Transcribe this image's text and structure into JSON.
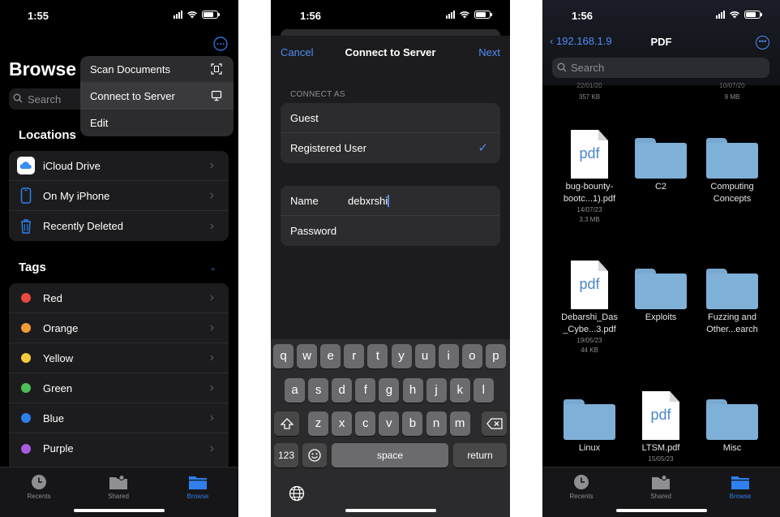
{
  "status": {
    "p1_time": "1:55",
    "p2_time": "1:56",
    "p3_time": "1:56"
  },
  "browse": {
    "title": "Browse",
    "search_placeholder": "Search",
    "locations_header": "Locations",
    "locations": [
      {
        "label": "iCloud Drive",
        "icon": "icloud-icon"
      },
      {
        "label": "On My iPhone",
        "icon": "iphone-icon"
      },
      {
        "label": "Recently Deleted",
        "icon": "trash-icon"
      }
    ],
    "tags_header": "Tags",
    "tags": [
      {
        "label": "Red",
        "color": "#e9493f"
      },
      {
        "label": "Orange",
        "color": "#f19a38"
      },
      {
        "label": "Yellow",
        "color": "#f4cb3a"
      },
      {
        "label": "Green",
        "color": "#4cbf5a"
      },
      {
        "label": "Blue",
        "color": "#2f80ed"
      },
      {
        "label": "Purple",
        "color": "#a95be0"
      }
    ],
    "menu": [
      {
        "label": "Scan Documents",
        "icon": "scan-icon"
      },
      {
        "label": "Connect to Server",
        "icon": "monitor-icon"
      },
      {
        "label": "Edit"
      }
    ]
  },
  "tabbar": {
    "recents": "Recents",
    "shared": "Shared",
    "browse": "Browse"
  },
  "connect": {
    "cancel": "Cancel",
    "title": "Connect to Server",
    "next": "Next",
    "connect_as": "CONNECT AS",
    "guest": "Guest",
    "registered": "Registered User",
    "name_label": "Name",
    "name_value": "debxrshi",
    "password_label": "Password"
  },
  "keyboard": {
    "row1": [
      "q",
      "w",
      "e",
      "r",
      "t",
      "y",
      "u",
      "i",
      "o",
      "p"
    ],
    "row2": [
      "a",
      "s",
      "d",
      "f",
      "g",
      "h",
      "j",
      "k",
      "l"
    ],
    "row3": [
      "z",
      "x",
      "c",
      "v",
      "b",
      "n",
      "m"
    ],
    "num": "123",
    "space": "space",
    "return": "return"
  },
  "folder_view": {
    "back": "192.168.1.9",
    "title": "PDF",
    "search_placeholder": "Search",
    "partial_top": [
      {
        "meta": "22/01/20",
        "size": "357 KB"
      },
      {
        "meta": "10/07/20",
        "size": "9 MB"
      }
    ],
    "doc_label": "pdf",
    "items": [
      {
        "type": "pdf",
        "name1": "bug-bounty-",
        "name2": "bootc...1).pdf",
        "date": "14/07/23",
        "size": "3.3 MB"
      },
      {
        "type": "folder",
        "name1": "C2",
        "name2": ""
      },
      {
        "type": "folder",
        "name1": "Computing",
        "name2": "Concepts"
      },
      {
        "type": "pdf",
        "name1": "Debarshi_Das",
        "name2": "_Cybe...3.pdf",
        "date": "19/05/23",
        "size": "44 KB"
      },
      {
        "type": "folder",
        "name1": "Exploits",
        "name2": ""
      },
      {
        "type": "folder",
        "name1": "Fuzzing and",
        "name2": "Other...earch"
      },
      {
        "type": "folder",
        "name1": "Linux",
        "name2": ""
      },
      {
        "type": "pdf",
        "name1": "LTSM.pdf",
        "name2": "",
        "date": "15/05/23",
        "size": ""
      },
      {
        "type": "folder",
        "name1": "Misc",
        "name2": ""
      }
    ]
  }
}
